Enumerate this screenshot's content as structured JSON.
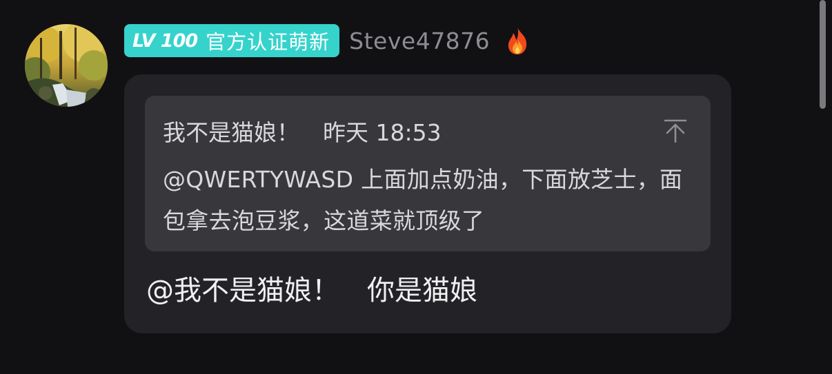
{
  "comment": {
    "level_badge": {
      "level_text": "LV 100",
      "title": "官方认证萌新",
      "color": "#35d3cc"
    },
    "username": "Steve47876",
    "status_icon": "fire-icon",
    "avatar_icon": "forest-waterfall-avatar",
    "quote": {
      "author": "我不是猫娘！",
      "time": "昨天 18:53",
      "body": "@QWERTYWASD 上面加点奶油，下面放芝士，面包拿去泡豆浆，这道菜就顶级了",
      "jump_icon": "arrow-up-to-top-icon"
    },
    "reply": {
      "mention": "@我不是猫娘！",
      "text": "你是猫娘"
    }
  },
  "colors": {
    "background": "#111114",
    "bubble": "#232327",
    "quote_box": "#38383c",
    "username": "#8d8d92"
  }
}
